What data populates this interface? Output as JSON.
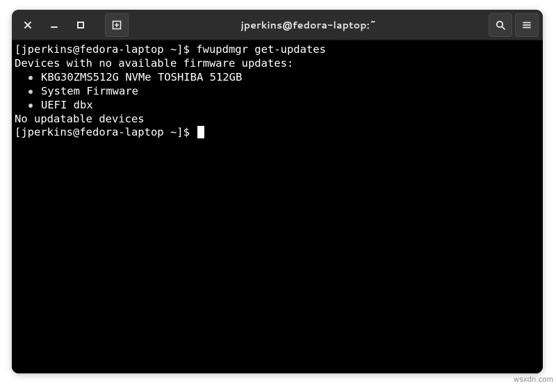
{
  "titlebar": {
    "title": "jperkins@fedora-laptop:~"
  },
  "terminal": {
    "prompt1": "[jperkins@fedora-laptop ~]$ ",
    "command1": "fwupdmgr get-updates",
    "header": "Devices with no available firmware updates:",
    "items": [
      "KBG30ZMS512G NVMe TOSHIBA 512GB",
      "System Firmware",
      "UEFI dbx"
    ],
    "footer": "No updatable devices",
    "prompt2": "[jperkins@fedora-laptop ~]$ "
  },
  "watermark": "wsxdn.com"
}
